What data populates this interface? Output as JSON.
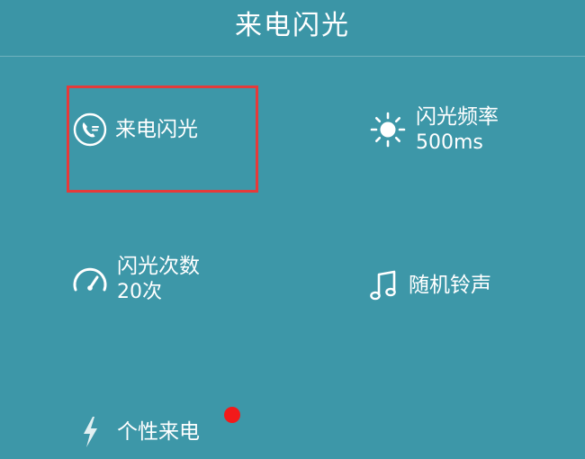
{
  "header": {
    "title": "来电闪光"
  },
  "items": [
    {
      "label": "来电闪光",
      "value": "",
      "icon": "phone-in-circle-icon"
    },
    {
      "label": "闪光频率",
      "value": "500ms",
      "icon": "sun-icon"
    },
    {
      "label": "闪光次数",
      "value": "20次",
      "icon": "speedometer-icon"
    },
    {
      "label": "随机铃声",
      "value": "",
      "icon": "music-note-icon"
    },
    {
      "label": "个性来电",
      "value": "",
      "icon": "lightning-icon"
    }
  ],
  "colors": {
    "background": "#3d97a8",
    "highlight_border": "#e53a3a",
    "badge": "#f21a1a",
    "text": "#ffffff"
  }
}
